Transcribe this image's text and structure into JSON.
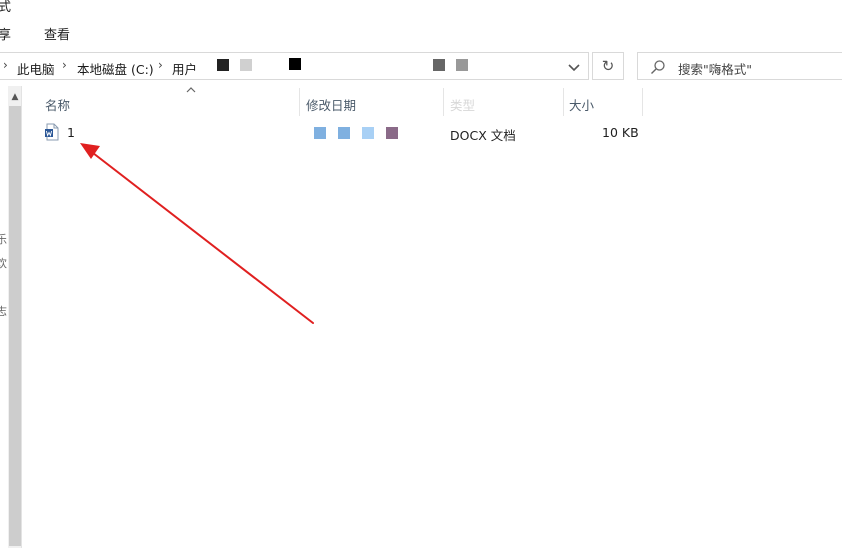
{
  "window": {
    "title_fragment": "式"
  },
  "ribbon": {
    "tabs": [
      {
        "label": "享"
      },
      {
        "label": "查看"
      }
    ]
  },
  "address": {
    "breadcrumbs": [
      {
        "label": "此电脑"
      },
      {
        "label": "本地磁盘 (C:)"
      },
      {
        "label": "用户"
      }
    ],
    "search_placeholder": "搜索\"嗨格式\""
  },
  "nav_fragments": [
    "›",
    "›",
    "›",
    "›",
    "乐",
    "欢",
    "志"
  ],
  "columns": {
    "name": "名称",
    "modified": "修改日期",
    "type": "类型",
    "size": "大小"
  },
  "files": [
    {
      "name": "1",
      "type": "DOCX 文档",
      "size": "10 KB"
    }
  ],
  "colors": {
    "annotation_arrow": "#e02020",
    "word_icon": "#2b5797"
  }
}
